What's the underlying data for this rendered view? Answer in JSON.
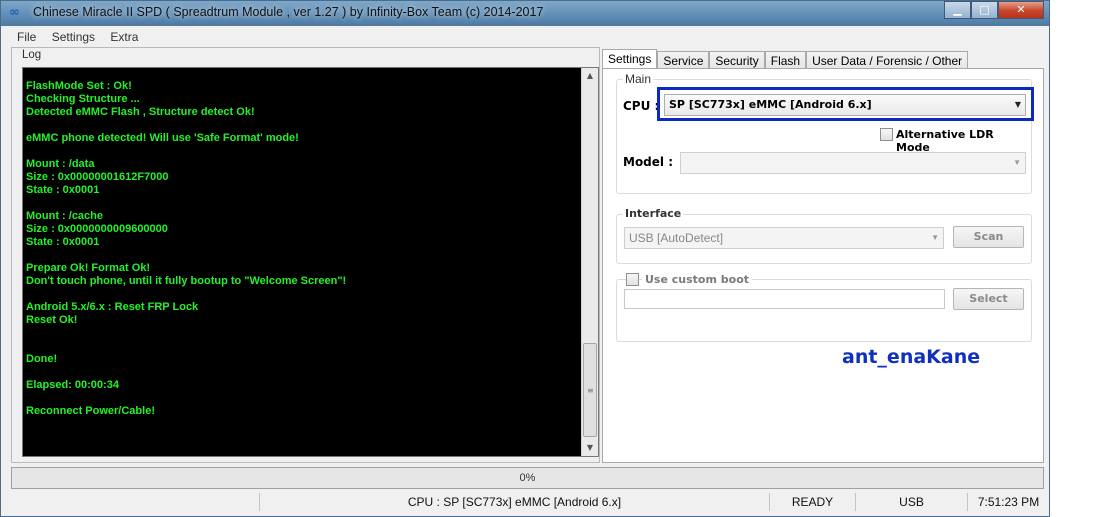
{
  "window": {
    "title": "Chinese Miracle II SPD ( Spreadtrum Module , ver 1.27 ) by Infinity-Box Team (c) 2014-2017",
    "app_icon": "infinity-icon",
    "buttons": {
      "minimize": "minimize-icon",
      "maximize": "maximize-icon",
      "close": "close-icon"
    }
  },
  "menu": [
    "File",
    "Settings",
    "Extra"
  ],
  "log": {
    "label": "Log",
    "text_color": "#25f02a",
    "lines": [
      "FlashMode Set : Ok!",
      "Checking Structure ...",
      "Detected eMMC Flash , Structure detect Ok!",
      "",
      "eMMC phone detected! Will use 'Safe Format' mode!",
      "",
      "Mount : /data",
      "Size  : 0x00000001612F7000",
      "State : 0x0001",
      "",
      "Mount : /cache",
      "Size  : 0x0000000009600000",
      "State : 0x0001",
      "",
      "Prepare Ok! Format Ok!",
      "Don't touch phone, until it fully bootup to \"Welcome Screen\"!",
      "",
      "Android 5.x/6.x : Reset FRP Lock",
      "Reset Ok!",
      "",
      "",
      "Done!",
      "",
      "Elapsed: 00:00:34",
      "",
      "Reconnect Power/Cable!"
    ]
  },
  "tabs": [
    "Settings",
    "Service",
    "Security",
    "Flash",
    "User Data / Forensic / Other"
  ],
  "settings": {
    "main_group": "Main",
    "cpu_label": "CPU :",
    "cpu_value": "SP [SC773x] eMMC [Android 6.x]",
    "highlight_color": "#0a2ac2",
    "alt_ldr_label": "Alternative LDR Mode",
    "alt_ldr_checked": false,
    "model_label": "Model :",
    "model_value": "",
    "interface_group": "Interface",
    "interface_value": "USB [AutoDetect]",
    "scan_button": "Scan",
    "custom_boot_label": "Use custom boot",
    "custom_boot_checked": false,
    "custom_boot_path": "",
    "select_button": "Select"
  },
  "watermark": "ant_enaKane",
  "progress": {
    "label": "0%",
    "value": 0
  },
  "status": {
    "cpu": "CPU : SP [SC773x] eMMC [Android 6.x]",
    "state": "READY",
    "interface": "USB",
    "time": "7:51:23 PM"
  }
}
